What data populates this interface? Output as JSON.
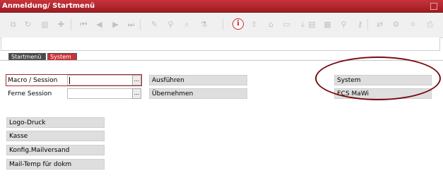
{
  "window": {
    "title": "Anmeldung/ Startmenü"
  },
  "toolbar": {
    "icons": [
      "copy-icon",
      "refresh-icon",
      "delete-icon",
      "add-icon",
      "first-icon",
      "prev-icon",
      "next-icon",
      "last-icon",
      "edit-icon",
      "link-icon",
      "search-record-icon",
      "filter-icon",
      "info-icon",
      "upload-icon",
      "home-icon",
      "window-icon",
      "export-icon",
      "document-icon",
      "folder-icon",
      "zoom-icon",
      "key-icon",
      "exchange-icon",
      "settings-icon",
      "tag-icon",
      "print-icon"
    ],
    "info_symbol": "i"
  },
  "tabs": [
    {
      "label": "Startmenü",
      "active": false
    },
    {
      "label": "System",
      "active": true
    }
  ],
  "form": {
    "macro_label": "Macro / Session",
    "macro_value": "",
    "remote_label": "Ferne Session",
    "remote_value": "",
    "dropdown_symbol": "...",
    "execute_button": "Ausführen",
    "apply_button": "Übernehmen"
  },
  "right_buttons": {
    "system": "System",
    "ecs_mawi": "ECS MaWi"
  },
  "left_buttons": [
    "Logo-Druck",
    "Kasse",
    "Konfig.Mailversand",
    "Mail-Temp für dokm"
  ],
  "colors": {
    "accent": "#b8262d",
    "highlight": "#7a0a10"
  }
}
